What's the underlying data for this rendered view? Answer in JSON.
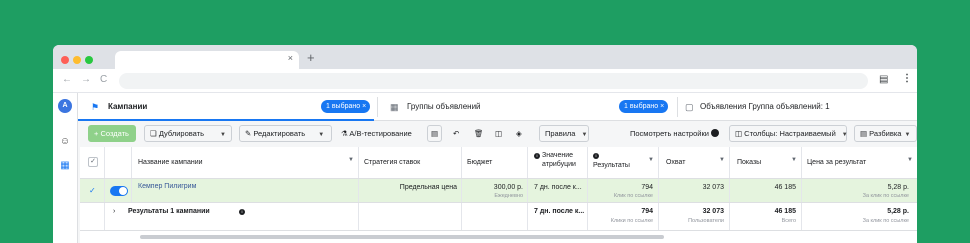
{
  "browser": {
    "window_colors": {
      "close": "#fe5f57",
      "minimize": "#febc2e",
      "maximize": "#28c840"
    },
    "tab_close": "×",
    "new_tab": "+",
    "back": "←",
    "forward": "→",
    "reload": "C",
    "more": "⋮"
  },
  "nav": {
    "avatar_initial": "A"
  },
  "tabs": {
    "campaigns": {
      "label": "Кампании",
      "badge": "1 выбрано ×"
    },
    "adsets": {
      "label": "Группы объявлений",
      "badge": "1 выбрано ×"
    },
    "ads": {
      "label": "Объявления Группа объявлений: 1"
    }
  },
  "actions": {
    "create": "+ Создать",
    "duplicate": "Дублировать",
    "edit": "Редактировать",
    "ab_test": "A/B-тестирование",
    "rules": "Правила",
    "view_settings": "Посмотреть настройки",
    "columns": "Столбцы: Настраиваемый",
    "breakdown": "Разбивка"
  },
  "table": {
    "headers": {
      "name": "Название кампании",
      "bid_strategy": "Стратегия ставок",
      "budget": "Бюджет",
      "attribution": "Значение атрибуции",
      "results": "Результаты",
      "reach": "Охват",
      "impressions": "Показы",
      "cost_per_result": "Цена за результат"
    },
    "campaign_row": {
      "name": "Кемпер Пилигрим",
      "bid_strategy": "Предельная цена",
      "budget": "300,00 р.",
      "budget_sub": "Ежедневно",
      "attribution": "7 дн. после к...",
      "results": "794",
      "results_sub": "Клик по ссылке",
      "reach": "32 073",
      "impressions": "46 185",
      "cost_per_result": "5,28 р.",
      "cost_sub": "За клик по ссылке"
    },
    "total_row": {
      "label": "Результаты 1 кампании",
      "attribution": "7 дн. после к...",
      "results": "794",
      "results_sub": "Клики по ссылке",
      "reach": "32 073",
      "reach_sub": "Пользователи",
      "impressions": "46 185",
      "impressions_sub": "Всего",
      "cost_per_result": "5,28 р.",
      "cost_sub": "За клик по ссылке"
    }
  },
  "colors": {
    "accent": "#1877f2",
    "page_bg": "#1e9e62",
    "selected_row": "#e5f4de",
    "create_btn": "#8fd18a"
  }
}
